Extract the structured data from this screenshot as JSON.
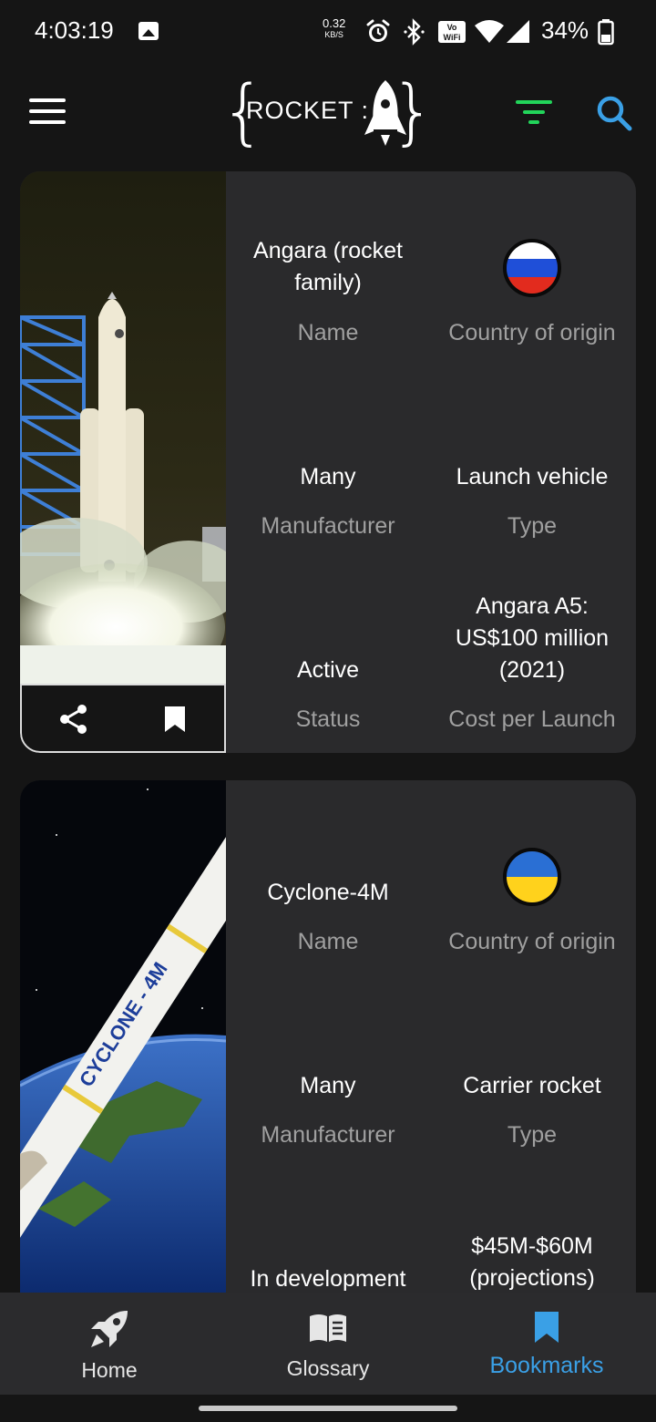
{
  "status_bar": {
    "time": "4:03:19",
    "net_speed": "0.32",
    "net_unit": "KB/S",
    "battery": "34%"
  },
  "app_bar": {
    "logo_text": "ROCKET :",
    "accent_filter": "#22d45a",
    "accent_search": "#3aa0e6"
  },
  "rockets": [
    {
      "name": "Angara (rocket family)",
      "name_label": "Name",
      "country_label": "Country of origin",
      "flag": "russia",
      "manufacturer": "Many",
      "manufacturer_label": "Manufacturer",
      "type": "Launch vehicle",
      "type_label": "Type",
      "status": "Active",
      "status_label": "Status",
      "cost": "Angara A5: US$100 million (2021)",
      "cost_label": "Cost per Launch"
    },
    {
      "name": "Cyclone-4M",
      "name_label": "Name",
      "country_label": "Country of origin",
      "flag": "ukraine",
      "manufacturer": "Many",
      "manufacturer_label": "Manufacturer",
      "type": "Carrier rocket",
      "type_label": "Type",
      "status": "In development",
      "cost": "$45M-$60M (projections)",
      "image_text": "CYCLONE - 4M"
    }
  ],
  "bottom_nav": {
    "home": "Home",
    "glossary": "Glossary",
    "bookmarks": "Bookmarks",
    "active": "bookmarks",
    "active_color": "#3aa0e6"
  }
}
